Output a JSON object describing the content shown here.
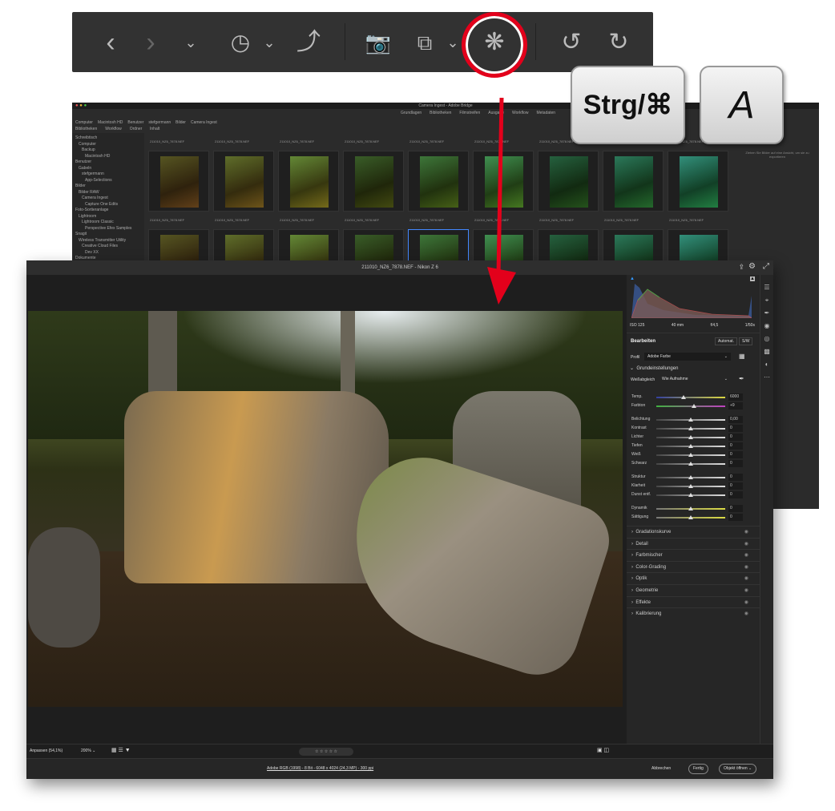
{
  "toolbar": {
    "icons": [
      "back-icon",
      "forward-icon",
      "chevron-down-icon",
      "recent-icon",
      "chevron-down-icon",
      "boomerang-icon",
      "camera-import-icon",
      "copy-icon",
      "chevron-down-icon",
      "camera-raw-icon",
      "rotate-left-icon",
      "rotate-right-icon"
    ],
    "highlight_color": "#e3001b"
  },
  "keys": {
    "modifier": "Strg/⌘",
    "letter": "A"
  },
  "bridge": {
    "title": "Camera Ingest - Adobe Bridge",
    "workspaces": [
      "Grundlagen",
      "Bibliotheken",
      "Filmstreifen",
      "Ausgabe",
      "Workflow",
      "Metadaten"
    ],
    "breadcrumb": [
      "Computer",
      "Macintosh HD",
      "Benutzer",
      "stefgermann",
      "Bilder",
      "Camera Ingest"
    ],
    "tabs": [
      "Bibliotheken",
      "Workflow",
      "Ordner"
    ],
    "content_tab": "Inhalt",
    "folders": [
      "Schreibtisch",
      "Computer",
      "Backup",
      "Macintosh HD",
      "Benutzer",
      "Gabeln",
      "stefgermann",
      "App-Selections",
      "Bilder",
      "Bilder RAW",
      "Camera Ingest",
      "Capture One Edits",
      "Foto-Sortieranlage",
      "Lightroom",
      "Lightroom Classic",
      "Perspective Efex Samples",
      "Snagit",
      "Wireless Transmitter Utility",
      "Creative Cloud Files",
      "Dev XX",
      "Dokumente"
    ],
    "thumb_label": "211010_NZ6_7878.NEF",
    "right_hint": "Ziehen Sie Bilder auf eine Ansicht, um sie zu exportieren"
  },
  "cr": {
    "title": "211010_NZ6_7878.NEF  -  Nikon Z 6",
    "exif": [
      "ISO 125",
      "40 mm",
      "f/4,5",
      "1/50s"
    ],
    "edit_label": "Bearbeiten",
    "auto_label": "Automat.",
    "bw_label": "S/W",
    "profile_label": "Profil",
    "profile_value": "Adobe Farbe",
    "basic_label": "Grundeinstellungen",
    "wb_label": "Weißabgleich",
    "wb_value": "Wie Aufnahme",
    "sliders": [
      {
        "label": "Temp.",
        "value": "6000",
        "pos": 0.4
      },
      {
        "label": "Farbton",
        "value": "+9",
        "pos": 0.55
      },
      {
        "label": "Belichtung",
        "value": "0,00",
        "pos": 0.5
      },
      {
        "label": "Kontrast",
        "value": "0",
        "pos": 0.5
      },
      {
        "label": "Lichter",
        "value": "0",
        "pos": 0.5
      },
      {
        "label": "Tiefen",
        "value": "0",
        "pos": 0.5
      },
      {
        "label": "Weiß",
        "value": "0",
        "pos": 0.5
      },
      {
        "label": "Schwarz",
        "value": "0",
        "pos": 0.5
      },
      {
        "label": "Struktur",
        "value": "0",
        "pos": 0.5
      },
      {
        "label": "Klarheit",
        "value": "0",
        "pos": 0.5
      },
      {
        "label": "Dunst entf.",
        "value": "0",
        "pos": 0.5
      },
      {
        "label": "Dynamik",
        "value": "0",
        "pos": 0.5
      },
      {
        "label": "Sättigung",
        "value": "0",
        "pos": 0.5
      }
    ],
    "sections": [
      "Gradationskurve",
      "Detail",
      "Farbmischer",
      "Color-Grading",
      "Optik",
      "Geometrie",
      "Effekte",
      "Kalibrierung"
    ],
    "zoom_fit": "Anpassen (54,1%)",
    "zoom_value": "200%",
    "rating": "☆ ☆ ☆ ☆ ☆",
    "status_info": "Adobe RGB (1998) - 8 Bit - 6048 x 4024 (24,3 MP) - 300 ppi",
    "cancel": "Abbrechen",
    "done": "Fertig",
    "open": "Objekt öffnen"
  }
}
